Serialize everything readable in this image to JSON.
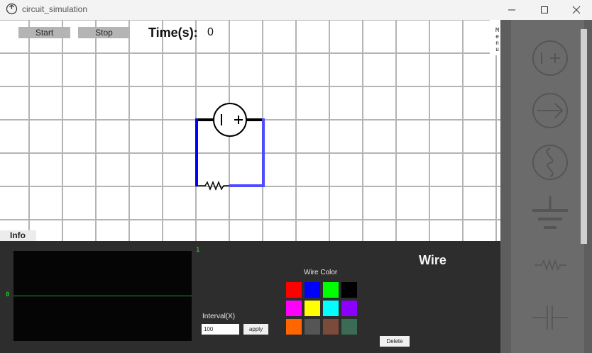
{
  "window": {
    "title": "circuit_simulation",
    "controls": [
      "minimize",
      "maximize",
      "close"
    ]
  },
  "toolbar": {
    "start_label": "Start",
    "stop_label": "Stop",
    "time_label": "Time(s):",
    "time_value": "0"
  },
  "menu_tab": {
    "label": "Menu"
  },
  "info_tab": {
    "label": "Info"
  },
  "oscilloscope": {
    "y_max_label": "1",
    "y_zero_label": "0"
  },
  "interval": {
    "label": "Interval(X)",
    "value": "100",
    "apply_label": "apply"
  },
  "wire_color": {
    "label": "Wire Color",
    "swatches": [
      "#ff0000",
      "#0000ff",
      "#00ff00",
      "#000000",
      "#ff00ff",
      "#ffff00",
      "#00ffff",
      "#8b00ff",
      "#ff6600",
      "#555555",
      "#7a4a3a",
      "#3b6b55"
    ]
  },
  "selected": {
    "title": "Wire",
    "delete_label": "Delete"
  },
  "circuit": {
    "components": [
      "dc-voltage-source",
      "resistor"
    ],
    "wire_colors": [
      "#000000",
      "#0000ff",
      "#4d4dff"
    ]
  },
  "palette": {
    "items": [
      "dc-source",
      "current-source",
      "ac-source",
      "ground",
      "resistor",
      "capacitor"
    ]
  }
}
